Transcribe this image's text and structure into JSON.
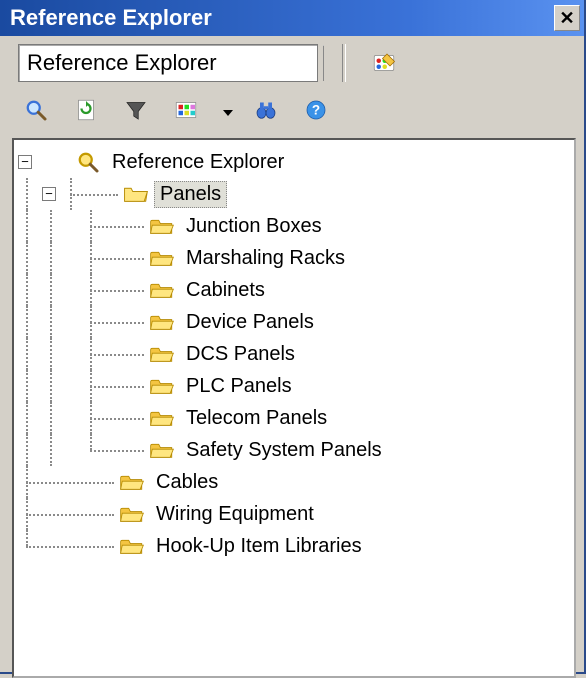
{
  "titlebar": {
    "title": "Reference Explorer"
  },
  "toolbar": {
    "combo_value": "Reference Explorer"
  },
  "tree": {
    "root": {
      "label": "Reference Explorer"
    },
    "panels": {
      "label": "Panels",
      "children": [
        "Junction Boxes",
        "Marshaling Racks",
        "Cabinets",
        "Device Panels",
        "DCS Panels",
        "PLC Panels",
        "Telecom Panels",
        "Safety System Panels"
      ]
    },
    "siblings": [
      "Cables",
      "Wiring Equipment",
      "Hook-Up Item Libraries"
    ]
  }
}
